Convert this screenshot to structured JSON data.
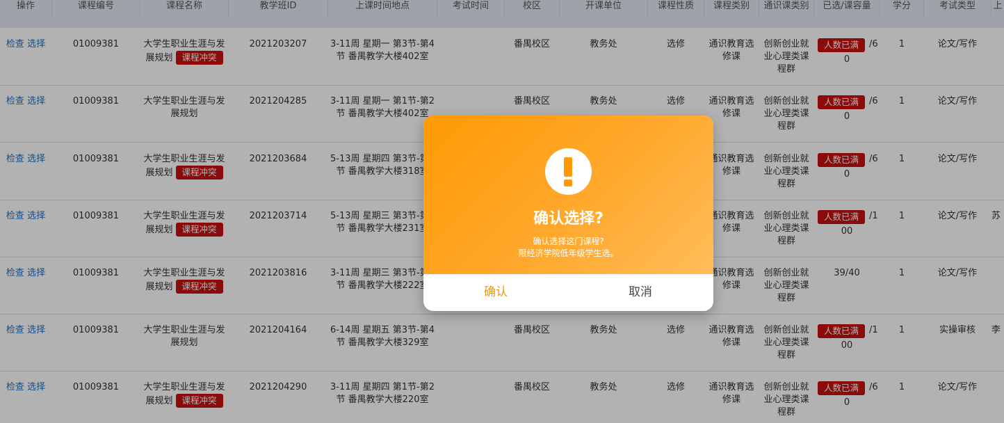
{
  "table": {
    "headers": [
      "操作",
      "课程编号",
      "课程名称",
      "教学班ID",
      "上课时间地点",
      "考试时间",
      "校区",
      "开课单位",
      "课程性质",
      "课程类别",
      "通识课类别",
      "已选/课容量",
      "学分",
      "考试类型",
      "上"
    ],
    "rows": [
      {
        "ops_check": "检查",
        "ops_select": "选择",
        "code": "01009381",
        "name1": "大学生职业生涯与发",
        "name2": "展规划",
        "conflict": "课程冲突",
        "class_id": "2021203207",
        "time1": "3-11周 星期一 第3节-第4",
        "time2": "节 番禺教学大楼402室",
        "campus": "番禺校区",
        "dept": "教务处",
        "nature": "选修",
        "cat1": "通识教育选",
        "cat2": "修课",
        "ge1": "创新创业就",
        "ge2": "业心理类课",
        "ge3": "程群",
        "full": "人数已满",
        "cap_tail": "/6",
        "cap2": "0",
        "credit": "1",
        "exam": "论文/写作",
        "extra": ""
      },
      {
        "ops_check": "检查",
        "ops_select": "选择",
        "code": "01009381",
        "name1": "大学生职业生涯与发",
        "name2": "展规划",
        "conflict": "",
        "class_id": "2021204285",
        "time1": "3-11周 星期一 第1节-第2",
        "time2": "节 番禺教学大楼402室",
        "campus": "番禺校区",
        "dept": "教务处",
        "nature": "选修",
        "cat1": "通识教育选",
        "cat2": "修课",
        "ge1": "创新创业就",
        "ge2": "业心理类课",
        "ge3": "程群",
        "full": "人数已满",
        "cap_tail": "/6",
        "cap2": "0",
        "credit": "1",
        "exam": "论文/写作",
        "extra": ""
      },
      {
        "ops_check": "检查",
        "ops_select": "选择",
        "code": "01009381",
        "name1": "大学生职业生涯与发",
        "name2": "展规划",
        "conflict": "课程冲突",
        "class_id": "2021203684",
        "time1": "5-13周 星期四 第3节-第4",
        "time2": "节 番禺教学大楼318室",
        "campus": "",
        "dept": "",
        "nature": "",
        "cat1": "通识教育选",
        "cat2": "修课",
        "ge1": "创新创业就",
        "ge2": "业心理类课",
        "ge3": "程群",
        "full": "人数已满",
        "cap_tail": "/6",
        "cap2": "0",
        "credit": "1",
        "exam": "论文/写作",
        "extra": ""
      },
      {
        "ops_check": "检查",
        "ops_select": "选择",
        "code": "01009381",
        "name1": "大学生职业生涯与发",
        "name2": "展规划",
        "conflict": "课程冲突",
        "class_id": "2021203714",
        "time1": "5-13周 星期三 第3节-第4",
        "time2": "节 番禺教学大楼231室",
        "campus": "",
        "dept": "",
        "nature": "",
        "cat1": "通识教育选",
        "cat2": "修课",
        "ge1": "创新创业就",
        "ge2": "业心理类课",
        "ge3": "程群",
        "full": "人数已满",
        "cap_tail": "/1",
        "cap2": "00",
        "credit": "1",
        "exam": "论文/写作",
        "extra": "苏"
      },
      {
        "ops_check": "检查",
        "ops_select": "选择",
        "code": "01009381",
        "name1": "大学生职业生涯与发",
        "name2": "展规划",
        "conflict": "课程冲突",
        "class_id": "2021203816",
        "time1": "3-11周 星期三 第3节-第4",
        "time2": "节 番禺教学大楼222室",
        "campus": "",
        "dept": "",
        "nature": "",
        "cat1": "通识教育选",
        "cat2": "修课",
        "ge1": "创新创业就",
        "ge2": "业心理类课",
        "ge3": "程群",
        "full": "",
        "cap_tail": "39/40",
        "cap2": "",
        "credit": "1",
        "exam": "论文/写作",
        "extra": ""
      },
      {
        "ops_check": "检查",
        "ops_select": "选择",
        "code": "01009381",
        "name1": "大学生职业生涯与发",
        "name2": "展规划",
        "conflict": "",
        "class_id": "2021204164",
        "time1": "6-14周 星期五 第3节-第4",
        "time2": "节 番禺教学大楼329室",
        "campus": "番禺校区",
        "dept": "教务处",
        "nature": "选修",
        "cat1": "通识教育选",
        "cat2": "修课",
        "ge1": "创新创业就",
        "ge2": "业心理类课",
        "ge3": "程群",
        "full": "人数已满",
        "cap_tail": "/1",
        "cap2": "00",
        "credit": "1",
        "exam": "实操审核",
        "extra": "李"
      },
      {
        "ops_check": "检查",
        "ops_select": "选择",
        "code": "01009381",
        "name1": "大学生职业生涯与发",
        "name2": "展规划",
        "conflict": "课程冲突",
        "class_id": "2021204290",
        "time1": "3-11周 星期四 第1节-第2",
        "time2": "节 番禺教学大楼220室",
        "campus": "番禺校区",
        "dept": "教务处",
        "nature": "选修",
        "cat1": "通识教育选",
        "cat2": "修课",
        "ge1": "创新创业就",
        "ge2": "业心理类课",
        "ge3": "程群",
        "full": "人数已满",
        "cap_tail": "/6",
        "cap2": "0",
        "credit": "1",
        "exam": "论文/写作",
        "extra": ""
      }
    ]
  },
  "modal": {
    "title": "确认选择?",
    "line1": "确认选择这门课程?",
    "line2": "限经济学院低年级学生选。",
    "confirm": "确认",
    "cancel": "取消"
  },
  "colors": {
    "accent": "#f39800",
    "danger": "#c80f0f",
    "link": "#1f6fc2"
  }
}
